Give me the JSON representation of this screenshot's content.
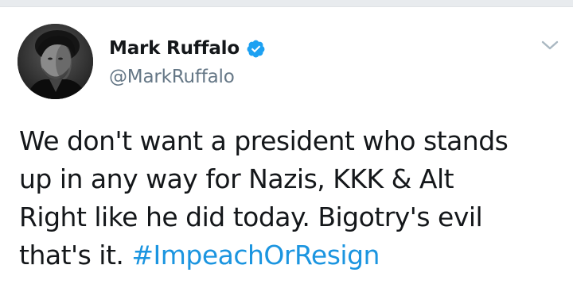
{
  "tweet": {
    "author": {
      "display_name": "Mark Ruffalo",
      "username": "@MarkRuffalo",
      "verified": true
    },
    "text_lines": [
      "We don't want a president who stands",
      "up in any way for Nazis, KKK & Alt",
      "Right like he did today. Bigotry's evil",
      "that's it."
    ],
    "hashtag": "#ImpeachOrResign"
  },
  "colors": {
    "hashtag": "#1b95e0",
    "verified": "#1da1f2",
    "secondary_text": "#657786",
    "primary_text": "#14171a"
  },
  "icons": {
    "verified": "verified-badge-icon",
    "menu": "chevron-down-icon"
  }
}
